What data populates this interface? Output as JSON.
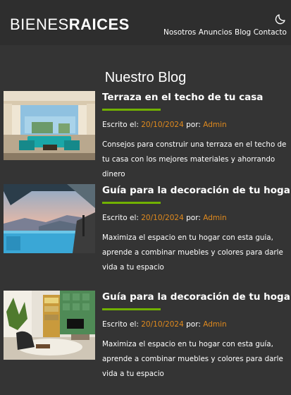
{
  "header": {
    "logo_light": "BIENES",
    "logo_bold": "RAICES",
    "theme_toggle_icon": "moon-icon",
    "nav": [
      "Nosotros",
      "Anuncios",
      "Blog",
      "Contacto"
    ]
  },
  "page": {
    "title": "Nuestro Blog"
  },
  "entries": [
    {
      "image_icon": "rooftop-terrace-photo",
      "title": "Terraza en el techo de tu casa",
      "written_label": "Escrito el:",
      "date": "20/10/2024",
      "by_label": "por:",
      "author": "Admin",
      "excerpt": "Consejos para construir una terraza en el techo de tu casa con los mejores materiales y ahorrando dinero"
    },
    {
      "image_icon": "infinity-pool-photo",
      "title": "Guía para la decoración de tu hogar",
      "written_label": "Escrito el:",
      "date": "20/10/2024",
      "by_label": "por:",
      "author": "Admin",
      "excerpt": "Maximiza el espacio en tu hogar con esta guia, aprende a combinar muebles y colores para darle vida a tu espacio"
    },
    {
      "image_icon": "living-room-photo",
      "title": "Guía para la decoración de tu hogar",
      "written_label": "Escrito el:",
      "date": "20/10/2024",
      "by_label": "por:",
      "author": "Admin",
      "excerpt": "Maximiza el espacio en tu hogar con esta guía, aprende a combinar muebles y colores para darle vida a tu espacio"
    }
  ],
  "colors": {
    "background": "#343434",
    "header": "#2e2e2e",
    "accent_green": "#71b100",
    "accent_orange": "#e08a1e"
  }
}
